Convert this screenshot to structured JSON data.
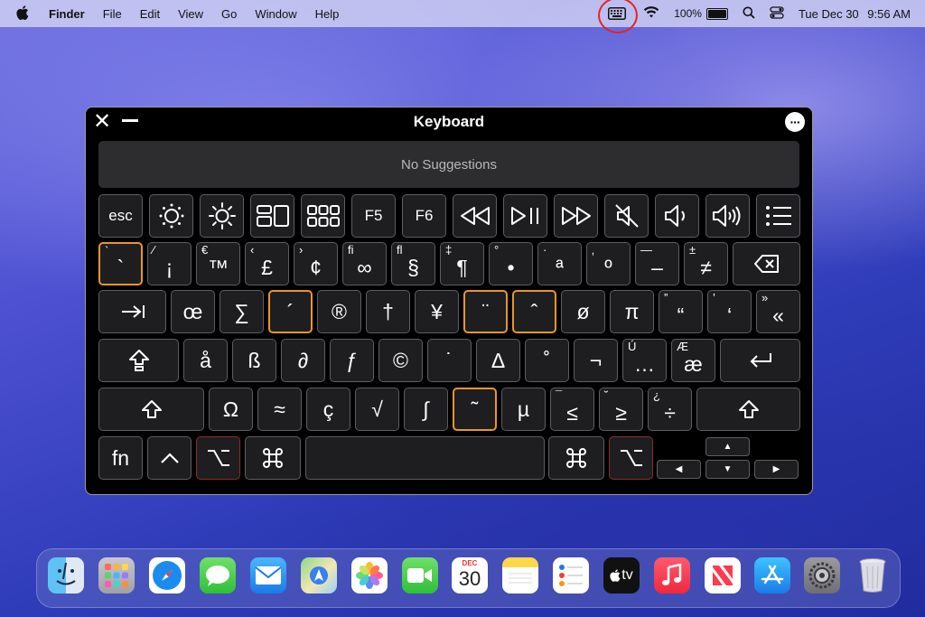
{
  "menubar": {
    "apple_icon": "apple-logo",
    "app_name": "Finder",
    "menus": [
      "File",
      "Edit",
      "View",
      "Go",
      "Window",
      "Help"
    ],
    "battery": "100%",
    "date": "Tue Dec 30",
    "time": "9:56 AM"
  },
  "keyboard_viewer": {
    "title": "Keyboard",
    "suggestions": "No Suggestions",
    "keys": {
      "esc": "esc",
      "f5": "F5",
      "f6": "F6",
      "r1": [
        {
          "sec": "`",
          "pri": "`"
        },
        {
          "sec": "⁄",
          "pri": "¡"
        },
        {
          "sec": "€",
          "pri": "™"
        },
        {
          "sec": "‹",
          "pri": "£"
        },
        {
          "sec": "›",
          "pri": "¢"
        },
        {
          "sec": "ﬁ",
          "pri": "∞"
        },
        {
          "sec": "ﬂ",
          "pri": "§"
        },
        {
          "sec": "‡",
          "pri": "¶"
        },
        {
          "sec": "°",
          "pri": "•"
        },
        {
          "sec": "·",
          "pri": "ª"
        },
        {
          "sec": "‚",
          "pri": "º"
        },
        {
          "sec": "—",
          "pri": "–"
        },
        {
          "sec": "±",
          "pri": "≠"
        }
      ],
      "r2": [
        {
          "sec": "",
          "pri": "œ"
        },
        {
          "sec": "",
          "pri": "∑"
        },
        {
          "sec": "",
          "pri": "´"
        },
        {
          "sec": "",
          "pri": "®"
        },
        {
          "sec": "",
          "pri": "†"
        },
        {
          "sec": "",
          "pri": "¥"
        },
        {
          "sec": "",
          "pri": "¨"
        },
        {
          "sec": "",
          "pri": "ˆ"
        },
        {
          "sec": "",
          "pri": "ø"
        },
        {
          "sec": "",
          "pri": "π"
        },
        {
          "sec": "”",
          "pri": "“"
        },
        {
          "sec": "’",
          "pri": "‘"
        },
        {
          "sec": "»",
          "pri": "«"
        }
      ],
      "r3": [
        {
          "sec": "",
          "pri": "å"
        },
        {
          "sec": "",
          "pri": "ß"
        },
        {
          "sec": "",
          "pri": "∂"
        },
        {
          "sec": "",
          "pri": "ƒ"
        },
        {
          "sec": "",
          "pri": "©"
        },
        {
          "sec": "",
          "pri": "˙"
        },
        {
          "sec": "",
          "pri": "∆"
        },
        {
          "sec": "",
          "pri": "˚"
        },
        {
          "sec": "",
          "pri": "¬"
        },
        {
          "sec": "Ú",
          "pri": "…"
        },
        {
          "sec": "Æ",
          "pri": "æ"
        }
      ],
      "r4": [
        {
          "sec": "",
          "pri": "Ω"
        },
        {
          "sec": "",
          "pri": "≈"
        },
        {
          "sec": "",
          "pri": "ç"
        },
        {
          "sec": "",
          "pri": "√"
        },
        {
          "sec": "",
          "pri": "∫"
        },
        {
          "sec": "",
          "pri": "˜"
        },
        {
          "sec": "",
          "pri": "µ"
        },
        {
          "sec": "¯",
          "pri": "≤"
        },
        {
          "sec": "˘",
          "pri": "≥"
        },
        {
          "sec": "¿",
          "pri": "÷"
        }
      ],
      "fn": "fn"
    }
  },
  "dock": {
    "calendar_month": "DEC",
    "calendar_day": "30",
    "apps": [
      "Finder",
      "Launchpad",
      "Safari",
      "Messages",
      "Mail",
      "Maps",
      "Photos",
      "FaceTime",
      "Calendar",
      "Notes",
      "Reminders",
      "TV",
      "Music",
      "News",
      "App Store",
      "System Settings",
      "Trash"
    ],
    "tv_label": "tv"
  }
}
